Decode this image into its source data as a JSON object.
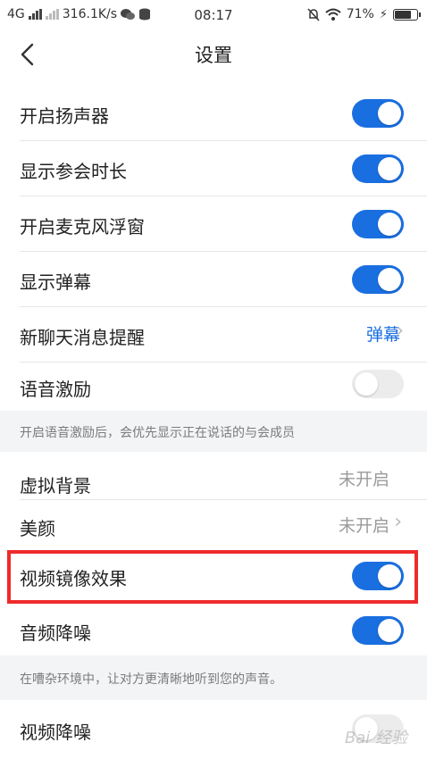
{
  "status_bar": {
    "network": "4G",
    "speed": "316.1K/s",
    "time": "08:17",
    "battery": "71%"
  },
  "header": {
    "title": "设置"
  },
  "settings_group1": [
    {
      "label": "开启扬声器",
      "toggle": true
    },
    {
      "label": "显示参会时长",
      "toggle": true
    },
    {
      "label": "开启麦克风浮窗",
      "toggle": true
    },
    {
      "label": "显示弹幕",
      "toggle": true
    },
    {
      "label": "新聊天消息提醒",
      "value": "弹幕"
    },
    {
      "label": "语音激励",
      "toggle": false
    }
  ],
  "note1": "开启语音激励后，会优先显示正在说话的与会成员",
  "settings_group2": [
    {
      "label": "虚拟背景",
      "value": "未开启"
    },
    {
      "label": "美颜",
      "value": "未开启"
    },
    {
      "label": "视频镜像效果",
      "toggle": true
    },
    {
      "label": "音频降噪",
      "toggle": true
    }
  ],
  "note2": "在嘈杂环境中，让对方更清晰地听到您的声音。",
  "settings_group3": [
    {
      "label": "视频降噪",
      "toggle": false
    }
  ],
  "watermark": "Bai 经验",
  "colors": {
    "accent": "#1a6fe0",
    "highlight": "#ee2b2b"
  }
}
